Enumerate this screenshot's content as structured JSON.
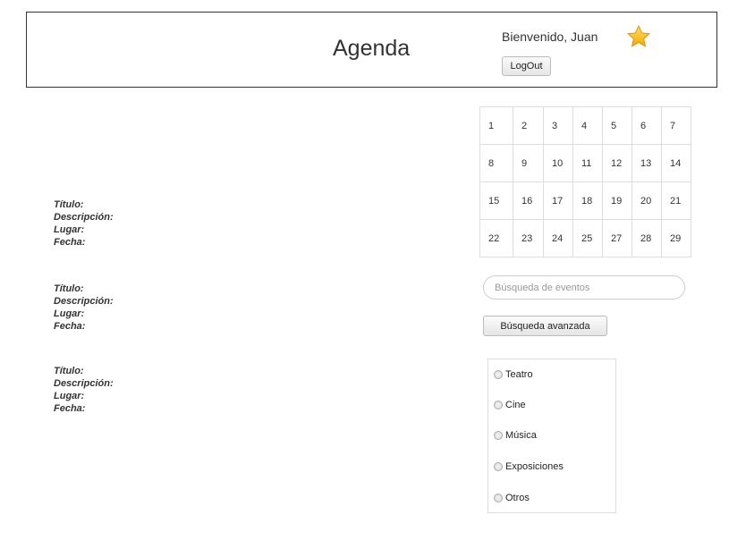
{
  "header": {
    "title": "Agenda",
    "welcome": "Bienvenido, Juan",
    "logout_label": "LogOut",
    "favorite_icon": "star-icon",
    "favorite_color": "#f5b800"
  },
  "events": [
    {
      "title_label": "Título:",
      "description_label": "Descripción:",
      "place_label": "Lugar:",
      "date_label": "Fecha:"
    },
    {
      "title_label": "Título:",
      "description_label": "Descripción:",
      "place_label": "Lugar:",
      "date_label": "Fecha:"
    },
    {
      "title_label": "Título:",
      "description_label": "Descripción:",
      "place_label": "Lugar:",
      "date_label": "Fecha:"
    }
  ],
  "calendar": {
    "weeks": [
      [
        "1",
        "2",
        "3",
        "4",
        "5",
        "6",
        "7"
      ],
      [
        "8",
        "9",
        "10",
        "11",
        "12",
        "13",
        "14"
      ],
      [
        "15",
        "16",
        "17",
        "18",
        "19",
        "20",
        "21"
      ],
      [
        "22",
        "23",
        "24",
        "25",
        "27",
        "28",
        "29"
      ]
    ]
  },
  "search": {
    "placeholder": "Búsqueda de eventos",
    "advanced_label": "Búsqueda avanzada"
  },
  "categories": [
    "Teatro",
    "Cine",
    "Música",
    "Exposiciones",
    "Otros"
  ]
}
